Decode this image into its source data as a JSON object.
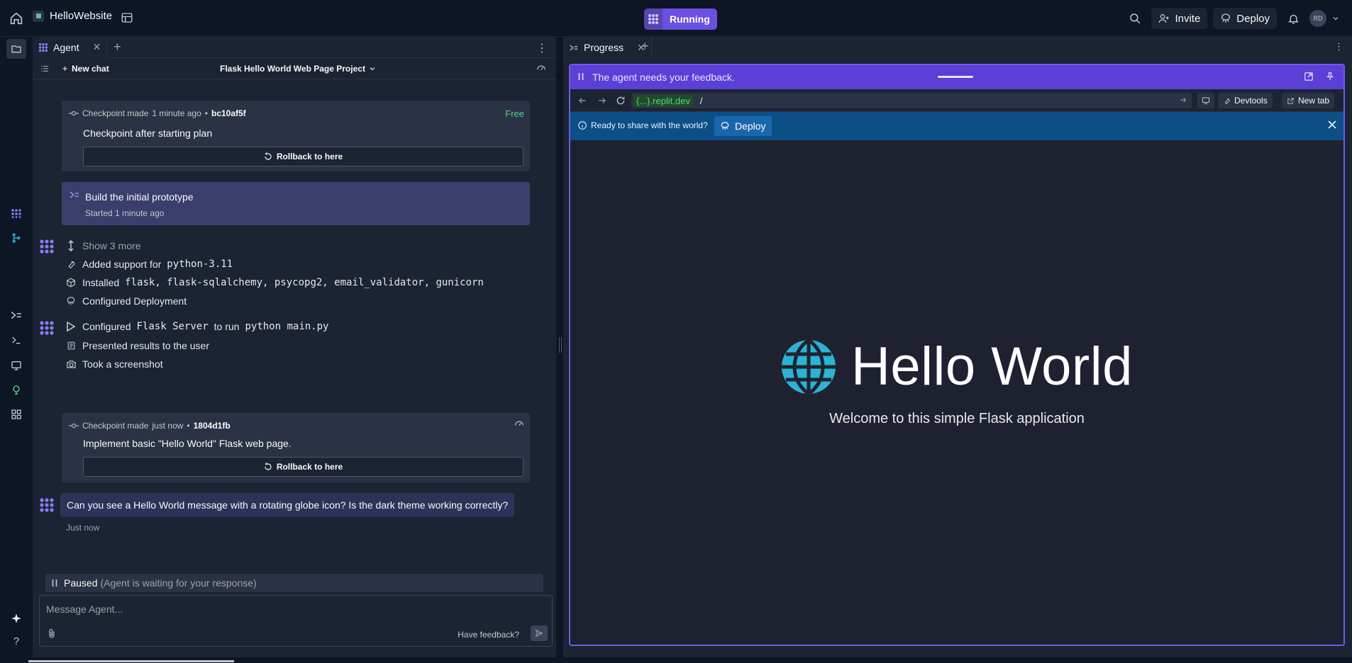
{
  "topbar": {
    "project_name": "HelloWebsite",
    "run_status": "Running",
    "invite_label": "Invite",
    "deploy_label": "Deploy",
    "avatar_initials": "RD"
  },
  "agent": {
    "tab_label": "Agent",
    "new_chat_label": "New chat",
    "chat_title": "Flask Hello World Web Page Project",
    "checkpoint1": {
      "made_label": "Checkpoint made",
      "time": "1 minute ago",
      "sep": "•",
      "hash": "bc10af5f",
      "price": "Free",
      "title": "Checkpoint after starting plan",
      "rollback_label": "Rollback to here"
    },
    "plan": {
      "title": "Build the initial prototype",
      "started_label": "Started",
      "started_time": "1 minute ago"
    },
    "actions": {
      "show_more": "Show 3 more",
      "added_support_prefix": "Added support for",
      "added_support_code": "python-3.11",
      "installed_prefix": "Installed",
      "installed_code": "flask, flask-sqlalchemy, psycopg2, email_validator, gunicorn",
      "configured_deployment": "Configured Deployment",
      "configured_prefix": "Configured",
      "configured_code1": "Flask Server",
      "configured_mid": "to run",
      "configured_code2": "python main.py",
      "presented": "Presented results to the user",
      "screenshot": "Took a screenshot"
    },
    "checkpoint2": {
      "made_label": "Checkpoint made",
      "time": "just now",
      "sep": "•",
      "hash": "1804d1fb",
      "title": "Implement basic \"Hello World\" Flask web page.",
      "rollback_label": "Rollback to here"
    },
    "question": "Can you see a Hello World message with a rotating globe icon? Is the dark theme working correctly?",
    "question_time": "Just now",
    "paused_label": "Paused",
    "paused_sub": "(Agent is waiting for your response)",
    "composer_placeholder": "Message Agent...",
    "feedback_label": "Have feedback?"
  },
  "progress": {
    "tab_label": "Progress",
    "feedback_banner": "The agent needs your feedback.",
    "url_chip": "{...}.replit.dev",
    "url_path": "/",
    "devtools_label": "Devtools",
    "new_tab_label": "New tab",
    "share_text": "Ready to share with the world?",
    "deploy_label": "Deploy",
    "site_heading": "Hello World",
    "site_subtitle": "Welcome to this simple Flask application"
  },
  "colors": {
    "accent": "#6b4fe0",
    "globe": "#2bb3d4",
    "banner_blue": "#0c4e86",
    "success_green": "#5dd18a"
  }
}
